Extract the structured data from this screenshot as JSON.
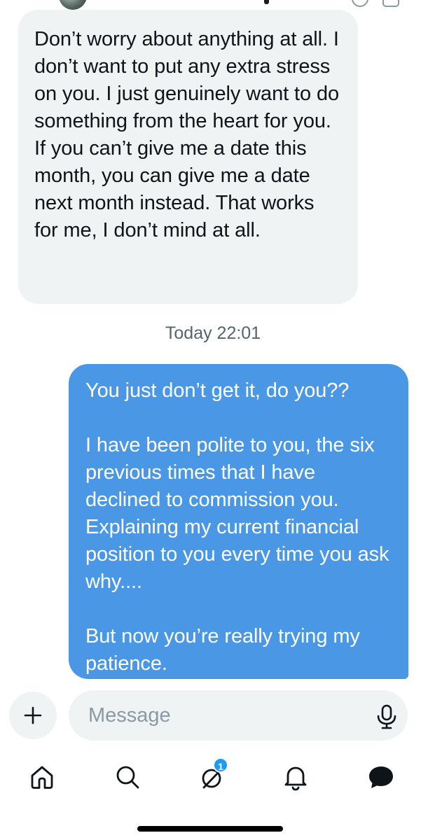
{
  "conversation": {
    "messages": [
      {
        "direction": "incoming",
        "text": "Don’t worry about anything at all. I don’t want to put any extra stress on you. I just genuinely want to do something from the heart for you. If you can’t give me a date this month, you can give me a date next month instead. That works for me, I don’t mind at all."
      },
      {
        "direction": "outgoing",
        "text": "You just don’t get it, do you??\n\nI have been polite to you, the six previous times that I have declined to commission you. Explaining my current financial position to you every time you ask why....\n\nBut now you’re really trying my patience."
      }
    ],
    "timestamp": "Today 22:01"
  },
  "composer": {
    "placeholder": "Message",
    "plus_icon": "plus-icon",
    "mic_icon": "microphone-icon"
  },
  "nav": {
    "items": [
      {
        "name": "home",
        "icon": "home-icon"
      },
      {
        "name": "search",
        "icon": "search-icon"
      },
      {
        "name": "grok",
        "icon": "grok-icon",
        "badge": "1"
      },
      {
        "name": "notifications",
        "icon": "bell-icon"
      },
      {
        "name": "messages",
        "icon": "chat-bubble-icon",
        "active": true
      }
    ]
  },
  "colors": {
    "outgoing_bubble": "#4a97e6",
    "incoming_bubble": "#eff3f4",
    "badge": "#1d9bf0",
    "timestamp": "#536471"
  }
}
